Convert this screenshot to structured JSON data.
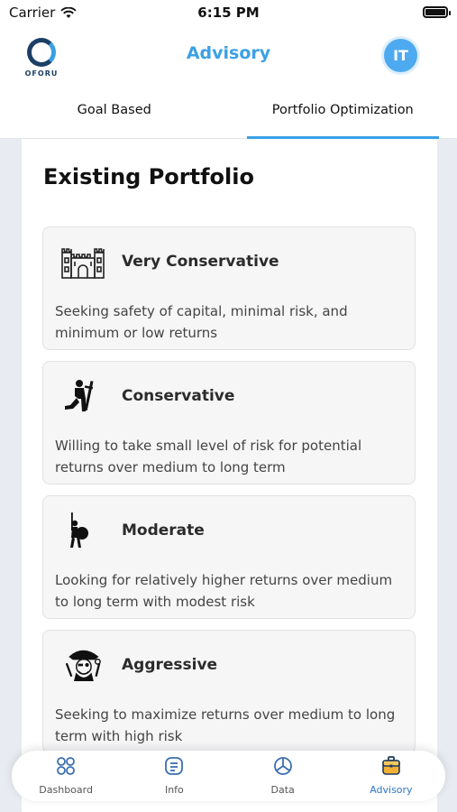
{
  "status": {
    "carrier": "Carrier",
    "time": "6:15 PM"
  },
  "header": {
    "title": "Advisory",
    "logo_text": "OFORU",
    "avatar_initials": "IT"
  },
  "tabs": [
    {
      "label": "Goal Based",
      "active": false
    },
    {
      "label": "Portfolio Optimization",
      "active": true
    }
  ],
  "section": {
    "title": "Existing Portfolio"
  },
  "cards": [
    {
      "title": "Very Conservative",
      "description": "Seeking safety of capital, minimal risk, and minimum or low returns",
      "icon": "castle-icon"
    },
    {
      "title": "Conservative",
      "description": "Willing to take small level of risk for potential returns over medium to long term",
      "icon": "kneeling-knight-icon"
    },
    {
      "title": "Moderate",
      "description": "Looking for relatively higher returns over medium to long term with modest risk",
      "icon": "warrior-shield-icon"
    },
    {
      "title": "Aggressive",
      "description": "Seeking to maximize returns over medium to long term with high risk",
      "icon": "pirate-icon"
    }
  ],
  "bottom_nav": [
    {
      "label": "Dashboard",
      "icon": "grid-icon",
      "active": false
    },
    {
      "label": "Info",
      "icon": "document-icon",
      "active": false
    },
    {
      "label": "Data",
      "icon": "pie-chart-icon",
      "active": false
    },
    {
      "label": "Advisory",
      "icon": "briefcase-icon",
      "active": true
    }
  ],
  "colors": {
    "accent": "#3aa0e6",
    "nav_active": "#2d76c6",
    "avatar": "#4eaaf0",
    "logo_dark": "#1c3f66"
  }
}
